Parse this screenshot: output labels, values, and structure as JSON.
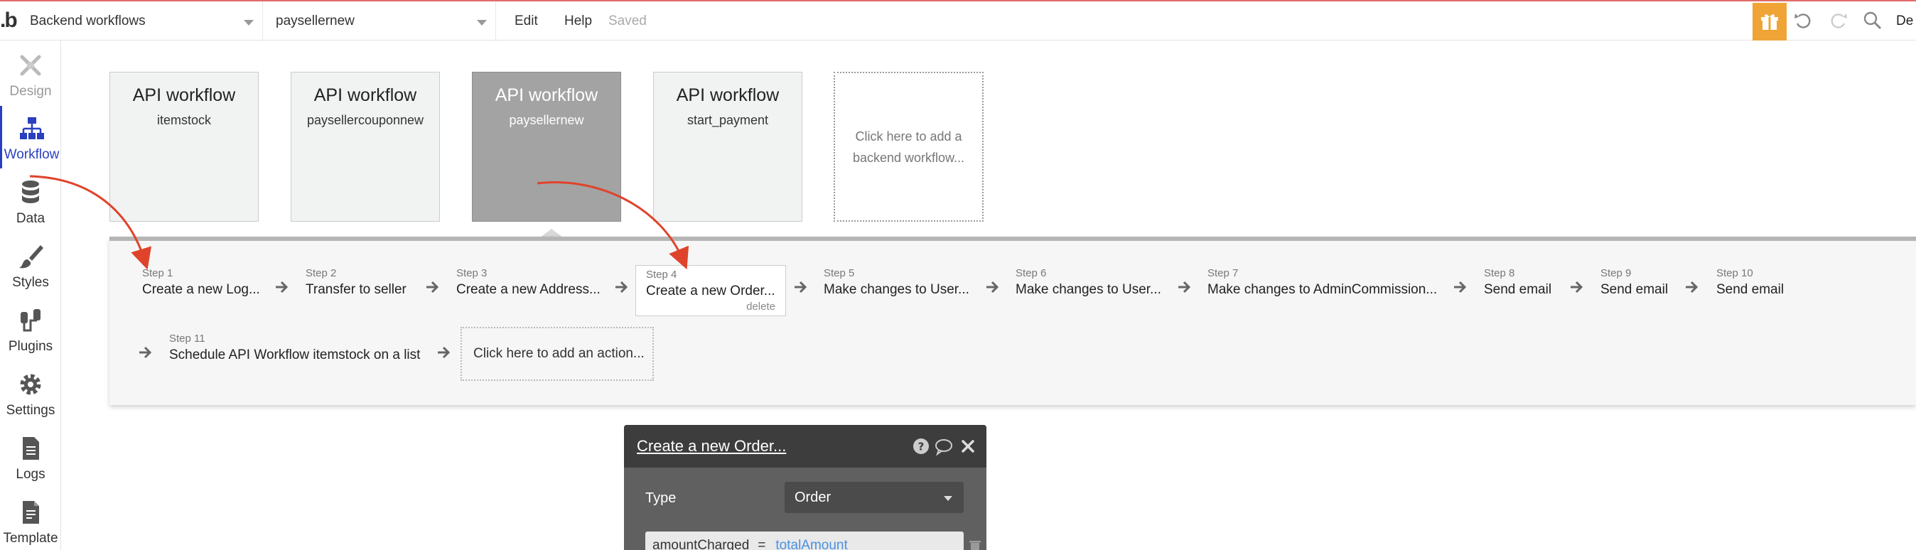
{
  "topbar": {
    "logo": ".b",
    "page_selector": "Backend workflows",
    "workflow_selector": "paysellernew",
    "menu_edit": "Edit",
    "menu_help": "Help",
    "status": "Saved",
    "user_truncated": "De",
    "accent_color": "#f0a436"
  },
  "sidebar": {
    "items": [
      {
        "label": "Design",
        "icon": "design-icon"
      },
      {
        "label": "Workflow",
        "icon": "workflow-icon"
      },
      {
        "label": "Data",
        "icon": "database-icon"
      },
      {
        "label": "Styles",
        "icon": "brush-icon"
      },
      {
        "label": "Plugins",
        "icon": "plug-icon"
      },
      {
        "label": "Settings",
        "icon": "gear-icon"
      },
      {
        "label": "Logs",
        "icon": "document-icon"
      },
      {
        "label": "Template",
        "icon": "template-icon"
      }
    ],
    "active_color": "#2a3fbf"
  },
  "workflows": [
    {
      "title": "API workflow",
      "name": "itemstock"
    },
    {
      "title": "API workflow",
      "name": "paysellercouponnew"
    },
    {
      "title": "API workflow",
      "name": "paysellernew"
    },
    {
      "title": "API workflow",
      "name": "start_payment"
    }
  ],
  "add_workflow": "Click here to add a backend workflow...",
  "steps": [
    {
      "num": "Step 1",
      "name": "Create a new Log..."
    },
    {
      "num": "Step 2",
      "name": "Transfer to seller"
    },
    {
      "num": "Step 3",
      "name": "Create a new Address..."
    },
    {
      "num": "Step 4",
      "name": "Create a new Order...",
      "delete": "delete"
    },
    {
      "num": "Step 5",
      "name": "Make changes to User..."
    },
    {
      "num": "Step 6",
      "name": "Make changes to User..."
    },
    {
      "num": "Step 7",
      "name": "Make changes to AdminCommission..."
    },
    {
      "num": "Step 8",
      "name": "Send email"
    },
    {
      "num": "Step 9",
      "name": "Send email"
    },
    {
      "num": "Step 10",
      "name": "Send email"
    },
    {
      "num": "Step 11",
      "name": "Schedule API Workflow itemstock on a list"
    }
  ],
  "add_action": "Click here to add an action...",
  "editor": {
    "title": "Create a new Order...",
    "type_label": "Type",
    "type_value": "Order",
    "field_name": "amountCharged",
    "field_op": "=",
    "field_expr": "totalAmount"
  }
}
